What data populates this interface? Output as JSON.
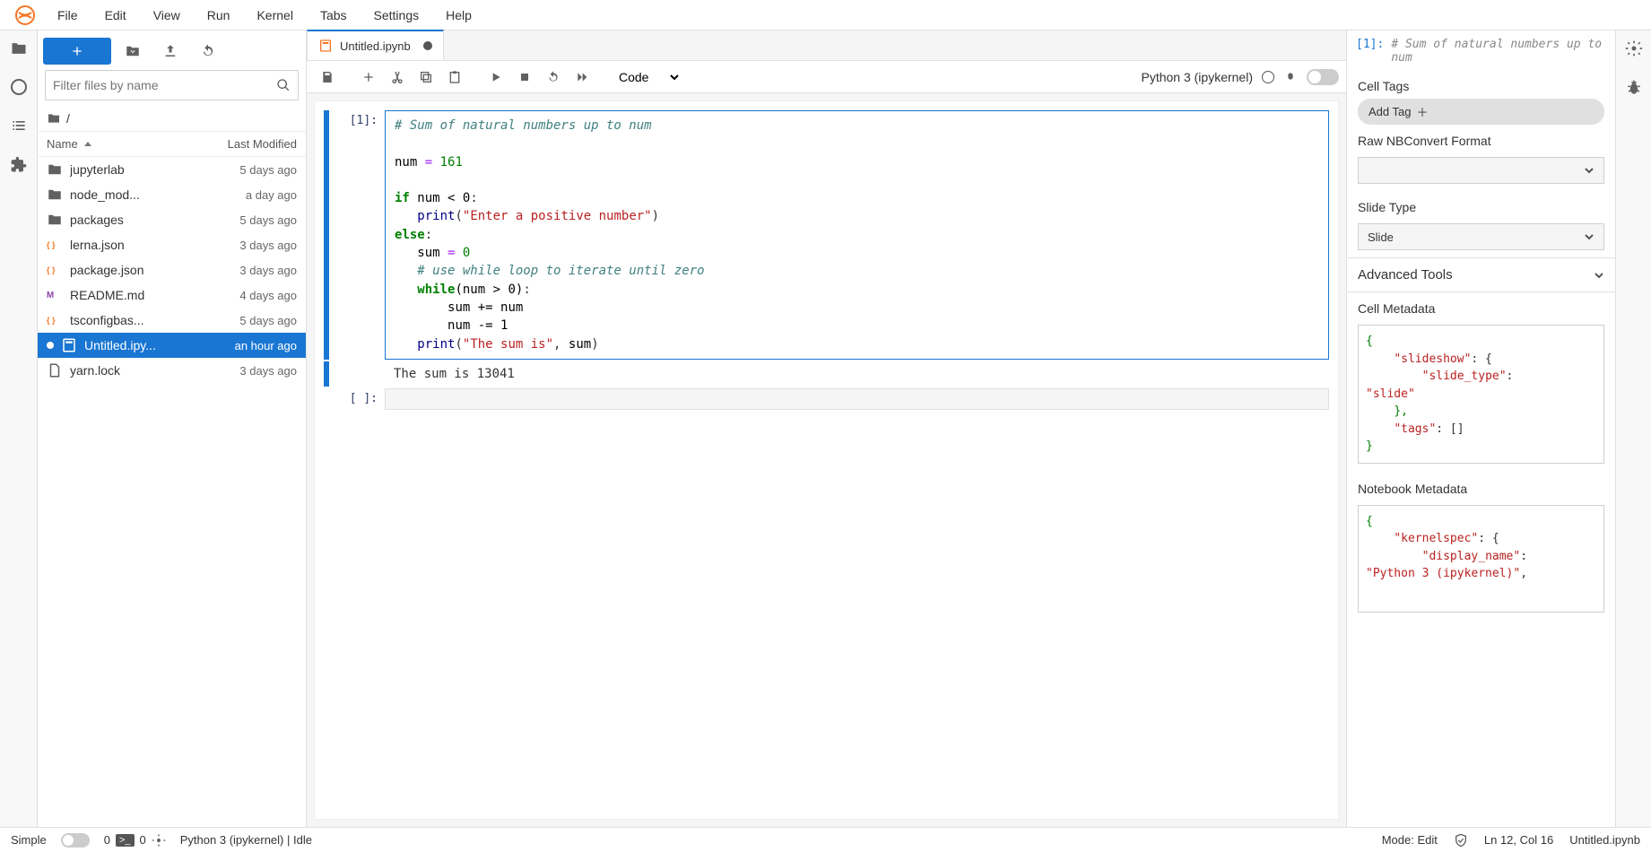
{
  "menus": [
    "File",
    "Edit",
    "View",
    "Run",
    "Kernel",
    "Tabs",
    "Settings",
    "Help"
  ],
  "file_panel": {
    "filter_placeholder": "Filter files by name",
    "breadcrumb_root": "/",
    "col_name": "Name",
    "col_modified": "Last Modified",
    "items": [
      {
        "icon": "folder",
        "name": "jupyterlab",
        "modified": "5 days ago"
      },
      {
        "icon": "folder",
        "name": "node_mod...",
        "modified": "a day ago"
      },
      {
        "icon": "folder",
        "name": "packages",
        "modified": "5 days ago"
      },
      {
        "icon": "json",
        "name": "lerna.json",
        "modified": "3 days ago"
      },
      {
        "icon": "json",
        "name": "package.json",
        "modified": "3 days ago"
      },
      {
        "icon": "md",
        "name": "README.md",
        "modified": "4 days ago"
      },
      {
        "icon": "json",
        "name": "tsconfigbas...",
        "modified": "5 days ago"
      },
      {
        "icon": "nb",
        "name": "Untitled.ipy...",
        "modified": "an hour ago",
        "selected": true,
        "dirty": true
      },
      {
        "icon": "file",
        "name": "yarn.lock",
        "modified": "3 days ago"
      }
    ]
  },
  "tab": {
    "title": "Untitled.ipynb"
  },
  "nb_toolbar": {
    "celltype": "Code",
    "kernel": "Python 3 (ipykernel)"
  },
  "cell": {
    "in_prompt": "[1]:",
    "empty_prompt": "[ ]:",
    "comment1": "# Sum of natural numbers up to num",
    "assign_lhs": "num",
    "assign_op": "=",
    "assign_val": "161",
    "kw_if": "if",
    "cond1": "num < 0",
    "print1_fn": "print",
    "print1_arg": "\"Enter a positive number\"",
    "kw_else": "else",
    "sum_init_lhs": "sum",
    "sum_init_op": "=",
    "sum_init_val": "0",
    "comment2": "# use while loop to iterate until zero",
    "kw_while": "while",
    "while_cond": "(num > 0)",
    "sum_add": "sum += num",
    "num_dec": "num -= 1",
    "print2_fn": "print",
    "print2_str": "\"The sum is\"",
    "print2_arg": "sum",
    "output": "The sum is 13041"
  },
  "inspector": {
    "prompt": "[1]:",
    "snippet": "# Sum of natural numbers up to num",
    "cell_tags_label": "Cell Tags",
    "add_tag": "Add Tag",
    "raw_label": "Raw NBConvert Format",
    "slide_label": "Slide Type",
    "slide_value": "Slide",
    "adv_label": "Advanced Tools",
    "cell_meta_label": "Cell Metadata",
    "nb_meta_label": "Notebook Metadata",
    "cell_meta": {
      "l1": "{",
      "l2_k": "\"slideshow\"",
      "l2_p": ": {",
      "l3_k": "\"slide_type\"",
      "l3_p": ":",
      "l4_v": "\"slide\"",
      "l5": "    },",
      "l6_k": "\"tags\"",
      "l6_p": ": []",
      "l7": "}"
    },
    "nb_meta": {
      "l1": "{",
      "l2_k": "\"kernelspec\"",
      "l2_p": ": {",
      "l3_k": "\"display_name\"",
      "l3_p": ":",
      "l4_v": "\"Python 3 (ipykernel)\""
    }
  },
  "status": {
    "simple": "Simple",
    "terminals": "0",
    "kernels": "0",
    "kernel_status": "Python 3 (ipykernel) | Idle",
    "mode": "Mode: Edit",
    "ln_col": "Ln 12, Col 16",
    "file": "Untitled.ipynb"
  }
}
